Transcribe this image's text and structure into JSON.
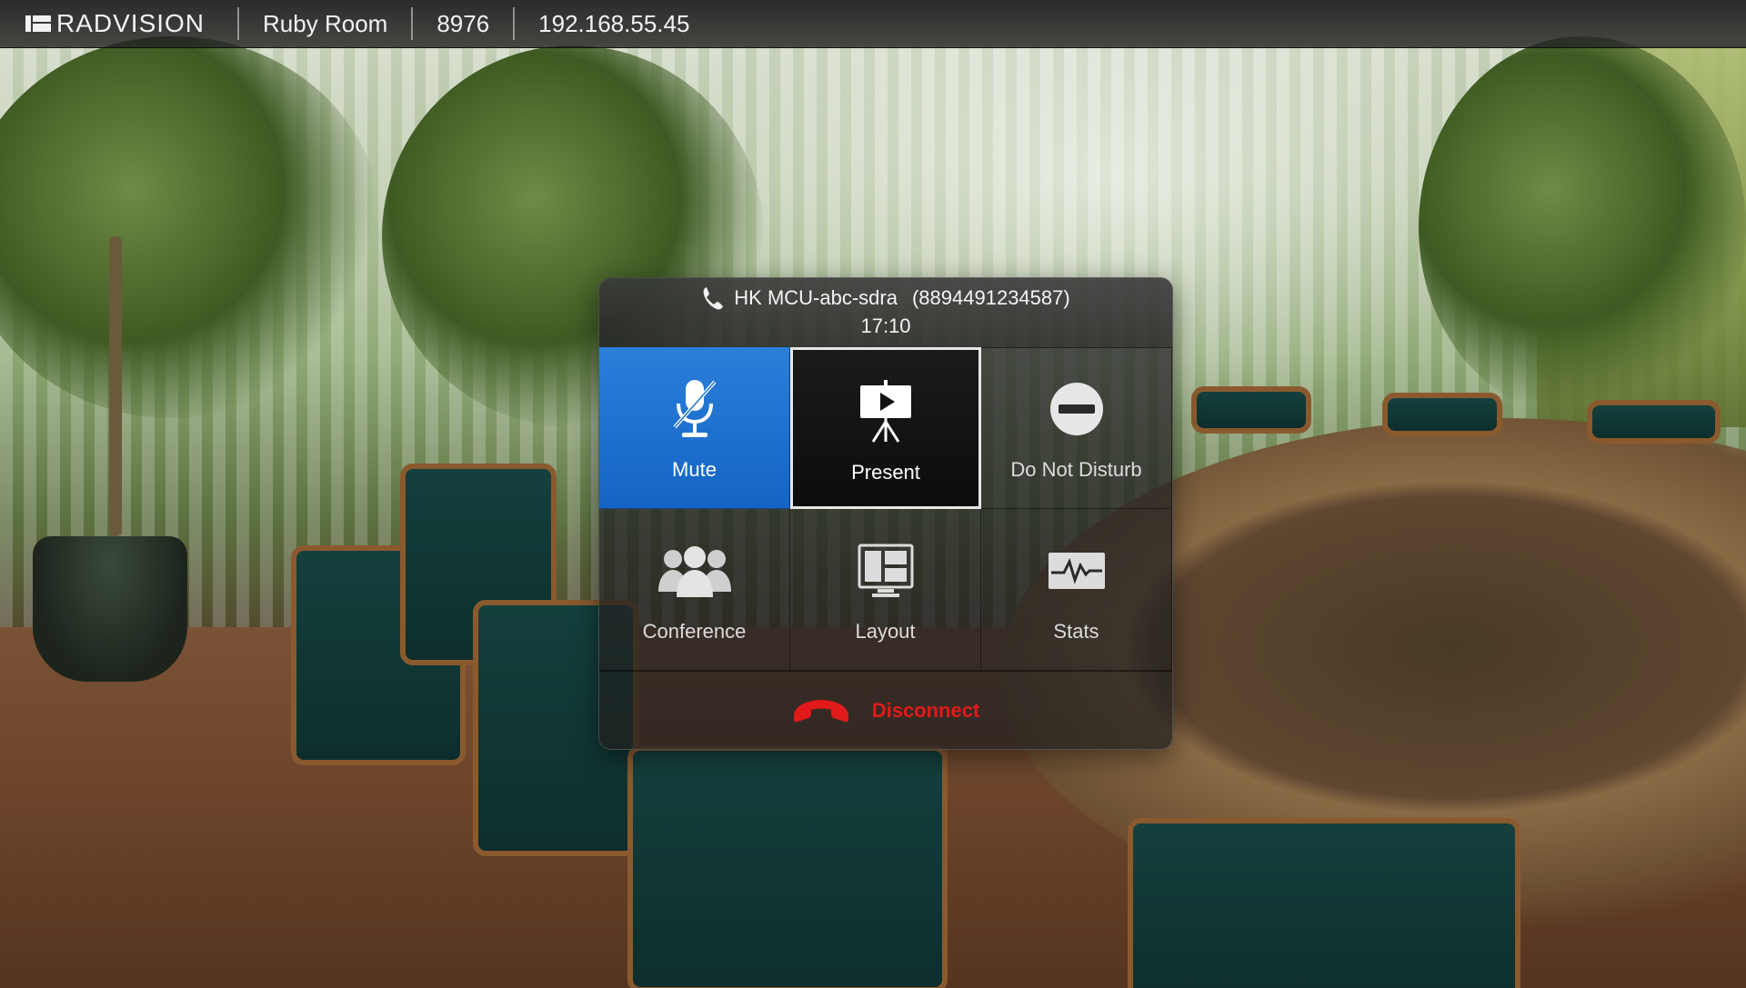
{
  "topbar": {
    "brand": "RADVISION",
    "room_name": "Ruby Room",
    "extension": "8976",
    "ip_address": "192.168.55.45"
  },
  "call_panel": {
    "call_name": "HK MCU-abc-sdra",
    "call_number": "(8894491234587)",
    "call_duration": "17:10",
    "tiles": [
      {
        "label": "Mute",
        "icon": "microphone-muted-icon",
        "state": "selected"
      },
      {
        "label": "Present",
        "icon": "presentation-board-icon",
        "state": "focused"
      },
      {
        "label": "Do Not Disturb",
        "icon": "do-not-disturb-icon",
        "state": "normal"
      },
      {
        "label": "Conference",
        "icon": "people-group-icon",
        "state": "normal"
      },
      {
        "label": "Layout",
        "icon": "layout-icon",
        "state": "normal"
      },
      {
        "label": "Stats",
        "icon": "stats-pulse-icon",
        "state": "normal"
      }
    ],
    "disconnect_label": "Disconnect"
  },
  "colors": {
    "selected_tile": "#1f74d2",
    "disconnect_red": "#e01a1a",
    "panel_bg": "#2a2a2a"
  }
}
